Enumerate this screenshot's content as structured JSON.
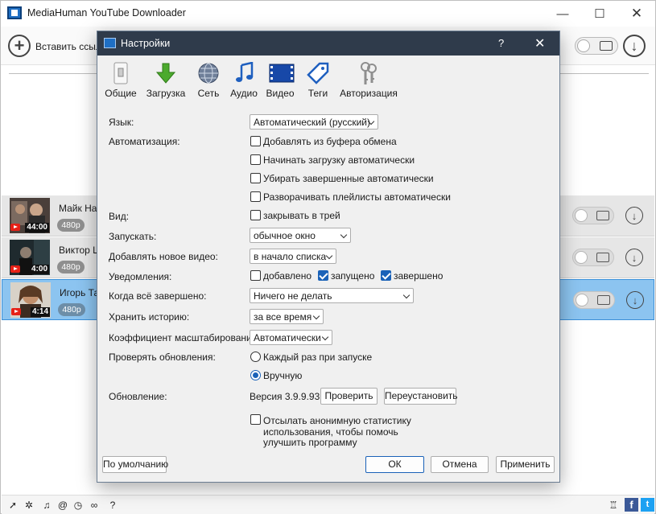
{
  "app": {
    "title": "MediaHuman YouTube Downloader",
    "window_controls": {
      "minimize": "—",
      "maximize": "☐",
      "close": "✕"
    },
    "toolbar": {
      "add_link_label": "Вставить ссылк"
    }
  },
  "videos": [
    {
      "title": "Майк Нау",
      "duration": "44:00",
      "quality": "480p",
      "selected": false
    },
    {
      "title": "Виктор Ц",
      "duration": "4:00",
      "quality": "480p",
      "selected": false
    },
    {
      "title": "Игорь Та",
      "duration": "4:14",
      "quality": "480p",
      "selected": true
    }
  ],
  "statusbar": {
    "icons": [
      "send-icon",
      "gear-icon",
      "music-icon",
      "snail-icon",
      "history-icon",
      "clock-icon",
      "binoculars-icon",
      "help-icon"
    ],
    "social": {
      "facebook": "f",
      "twitter": "t"
    }
  },
  "dialog": {
    "title": "Настройки",
    "help": "?",
    "close": "✕",
    "tabs": [
      {
        "label": "Общие",
        "icon": "switch-icon"
      },
      {
        "label": "Загрузка",
        "icon": "download-arrow-icon"
      },
      {
        "label": "Сеть",
        "icon": "globe-icon"
      },
      {
        "label": "Аудио",
        "icon": "music-note-icon"
      },
      {
        "label": "Видео",
        "icon": "film-icon"
      },
      {
        "label": "Теги",
        "icon": "tag-icon"
      },
      {
        "label": "Авторизация",
        "icon": "keys-icon"
      }
    ],
    "language": {
      "label": "Язык:",
      "value": "Автоматический (русский)"
    },
    "automation": {
      "label": "Автоматизация:",
      "options": [
        {
          "label": "Добавлять из буфера обмена",
          "checked": false
        },
        {
          "label": "Начинать загрузку автоматически",
          "checked": false
        },
        {
          "label": "Убирать завершенные автоматически",
          "checked": false
        },
        {
          "label": "Разворачивать плейлисты автоматически",
          "checked": false
        }
      ]
    },
    "view": {
      "label": "Вид:",
      "option": "закрывать в трей",
      "checked": false
    },
    "launch": {
      "label": "Запускать:",
      "value": "обычное окно"
    },
    "add_new_video": {
      "label": "Добавлять новое видео:",
      "value": "в начало списка"
    },
    "notifications": {
      "label": "Уведомления:",
      "options": [
        {
          "label": "добавлено",
          "checked": false
        },
        {
          "label": "запущено",
          "checked": true
        },
        {
          "label": "завершено",
          "checked": true
        }
      ]
    },
    "when_done": {
      "label": "Когда всё завершено:",
      "value": "Ничего не делать"
    },
    "history": {
      "label": "Хранить историю:",
      "value": "за все время"
    },
    "scale": {
      "label": "Коэффициент масштабирования:",
      "value": "Автоматически"
    },
    "check_updates": {
      "label": "Проверять обновления:",
      "options": [
        {
          "label": "Каждый раз при запуске",
          "selected": false
        },
        {
          "label": "Вручную",
          "selected": true
        }
      ]
    },
    "update": {
      "label": "Обновление:",
      "version": "Версия 3.9.9.93",
      "check_button": "Проверить",
      "reinstall_button": "Переустановить"
    },
    "stats": {
      "line1": "Отсылать анонимную статистику",
      "line2": "использования, чтобы помочь",
      "line3": "улучшить программу",
      "checked": false
    },
    "buttons": {
      "defaults": "По умолчанию",
      "ok": "ОК",
      "cancel": "Отмена",
      "apply": "Применить"
    }
  }
}
